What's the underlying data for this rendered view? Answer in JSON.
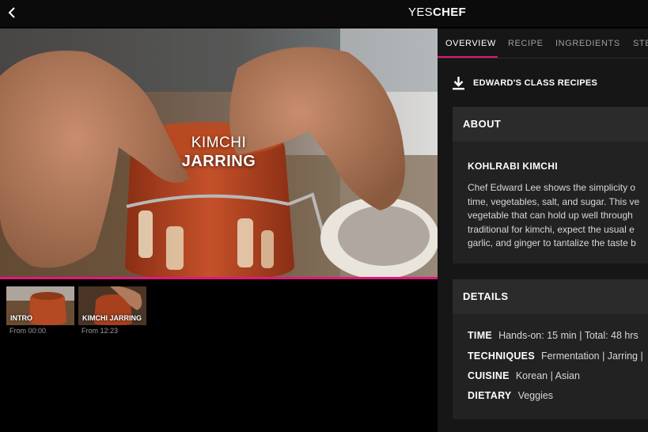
{
  "header": {
    "brand_part1": "YES",
    "brand_part2": "CHEF"
  },
  "video": {
    "title_line1": "KIMCHI",
    "title_line2": "JARRING",
    "progress_fraction": 1.0
  },
  "chapters": [
    {
      "label": "INTRO",
      "time": "From 00:00"
    },
    {
      "label": "KIMCHI JARRING",
      "time": "From 12:23"
    }
  ],
  "tabs": [
    {
      "label": "OVERVIEW",
      "active": true
    },
    {
      "label": "RECIPE",
      "active": false
    },
    {
      "label": "INGREDIENTS",
      "active": false
    },
    {
      "label": "STE",
      "active": false
    }
  ],
  "download": {
    "label": "EDWARD'S CLASS RECIPES"
  },
  "about": {
    "heading": "ABOUT",
    "title": "KOHLRABI KIMCHI",
    "lines": [
      "Chef Edward Lee shows the simplicity o",
      "time, vegetables, salt, and sugar. This ve",
      "vegetable that can hold up well through",
      "traditional for kimchi, expect the usual e",
      "garlic, and ginger to tantalize the taste b"
    ]
  },
  "details": {
    "heading": "DETAILS",
    "rows": [
      {
        "key": "TIME",
        "value": "Hands-on: 15 min | Total: 48 hrs"
      },
      {
        "key": "TECHNIQUES",
        "value": "Fermentation | Jarring |"
      },
      {
        "key": "CUISINE",
        "value": "Korean | Asian"
      },
      {
        "key": "DIETARY",
        "value": "Veggies"
      }
    ]
  },
  "colors": {
    "accent": "#e0197a",
    "panel_bg": "#161616",
    "card_bg": "#222222"
  },
  "icons": {
    "back": "chevron-left-icon",
    "download": "download-icon"
  }
}
